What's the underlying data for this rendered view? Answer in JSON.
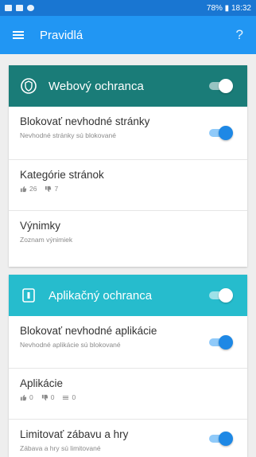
{
  "statusbar": {
    "right_text": "78% ▮ 18:32"
  },
  "toolbar": {
    "title": "Pravidlá",
    "help": "?"
  },
  "web": {
    "header": "Webový ochranca",
    "items": [
      {
        "title": "Blokovať nevhodné stránky",
        "subtitle": "Nevhodné stránky sú blokované"
      },
      {
        "title": "Kategórie stránok",
        "stat_allowed": "26",
        "stat_blocked": "7"
      },
      {
        "title": "Výnimky",
        "subtitle": "Zoznam výnimiek"
      }
    ]
  },
  "apps": {
    "header": "Aplikačný ochranca",
    "items": [
      {
        "title": "Blokovať nevhodné aplikácie",
        "subtitle": "Nevhodné aplikácie sú blokované"
      },
      {
        "title": "Aplikácie",
        "stat_allowed": "0",
        "stat_blocked": "0",
        "stat_limited": "0"
      },
      {
        "title": "Limitovať zábavu a hry",
        "subtitle": "Zábava a hry sú limitované"
      }
    ]
  },
  "colors": {
    "toolbar": "#2196f3",
    "web_header": "#1a7c78",
    "apps_header": "#26bccd",
    "toggle": "#1e88e5"
  },
  "icons": [
    "hamburger-icon",
    "help-icon",
    "globe-shield-icon",
    "app-lock-icon",
    "thumb-up-icon",
    "thumb-down-icon",
    "timer-icon"
  ]
}
